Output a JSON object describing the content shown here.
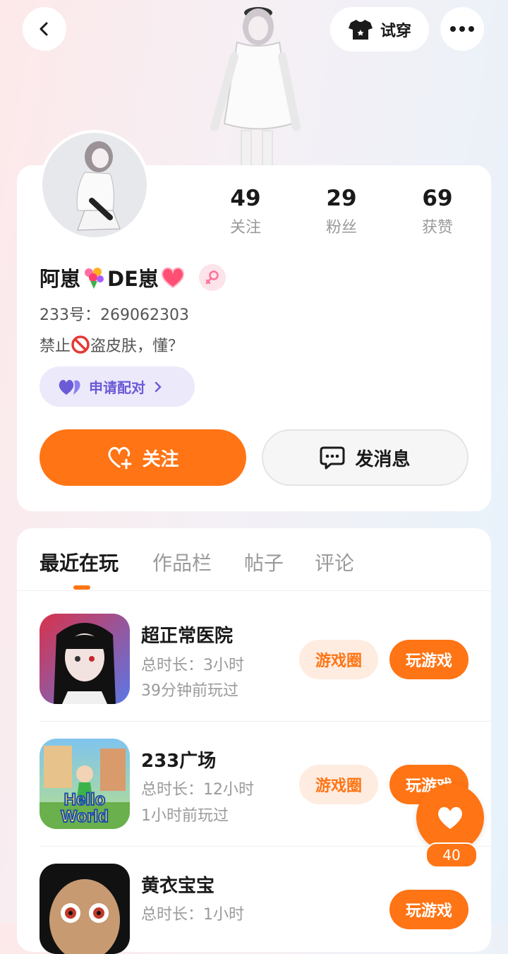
{
  "header": {
    "tryon_label": "试穿"
  },
  "profile": {
    "stats": [
      {
        "value": "49",
        "label": "关注"
      },
      {
        "value": "29",
        "label": "粉丝"
      },
      {
        "value": "69",
        "label": "获赞"
      }
    ],
    "name_part1": "阿崽",
    "name_part2": "DE崽",
    "id_line": "233号：269062303",
    "bio_prefix": "禁止",
    "bio_suffix": "盗皮肤，懂？",
    "pair_label": "申请配对",
    "follow_label": "关注",
    "message_label": "发消息"
  },
  "tabs": [
    {
      "label": "最近在玩"
    },
    {
      "label": "作品栏"
    },
    {
      "label": "帖子"
    },
    {
      "label": "评论"
    }
  ],
  "games": [
    {
      "title": "超正常医院",
      "duration": "总时长：3小时",
      "last_played": "39分钟前玩过",
      "circle_label": "游戏圈",
      "play_label": "玩游戏"
    },
    {
      "title": "233广场",
      "duration": "总时长：12小时",
      "last_played": "1小时前玩过",
      "circle_label": "游戏圈",
      "play_label": "玩游戏",
      "icon_text1": "Hello",
      "icon_text2": "World"
    },
    {
      "title": "黄衣宝宝",
      "duration": "总时长：1小时",
      "play_label": "玩游戏"
    }
  ],
  "like_count": "40",
  "colors": {
    "accent": "#ff7414",
    "pair": "#6a5bd6"
  }
}
